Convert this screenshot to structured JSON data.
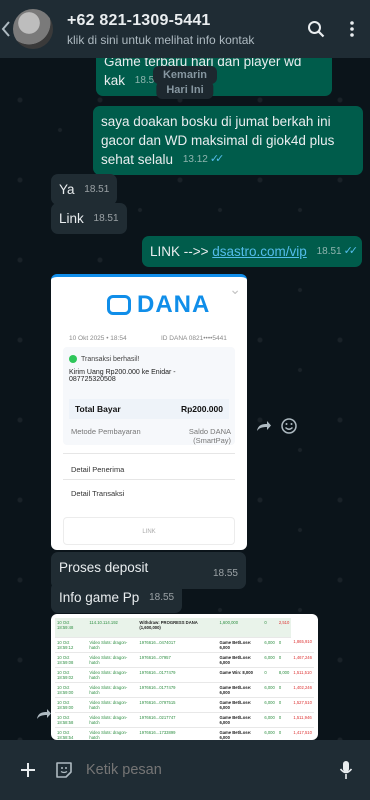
{
  "contact": {
    "name": "+62 821-1309-5441",
    "subtitle": "klik di sini untuk melihat info kontak"
  },
  "dates": {
    "yesterday": "Kemarin",
    "today": "Hari Ini"
  },
  "messages": {
    "cut_top": {
      "text": "Game terbaru hari dan player wd kak",
      "time": "18.58"
    },
    "prayer": {
      "text": "saya doakan bosku di jumat berkah ini gacor dan WD maksimal di giok4d plus sehat selalu",
      "time": "13.12"
    },
    "ya": {
      "text": "Ya",
      "time": "18.51"
    },
    "link_in": {
      "text": "Link",
      "time": "18.51"
    },
    "link_out": {
      "prefix": "LINK -->> ",
      "url": "dsastro.com/vip",
      "time": "18.51"
    },
    "deposit": {
      "text": "Proses deposit",
      "time": "18.55"
    },
    "info": {
      "text": "Info game Pp",
      "time": "18.55"
    }
  },
  "receipt": {
    "brand": "DANA",
    "date": "10 Okt 2025 • 18:54",
    "id": "ID DANA 0821••••5441",
    "status": "Transaksi berhasil!",
    "desc": "Kirim Uang Rp200.000 ke Enidar - 087725320508",
    "total_label": "Total Bayar",
    "total_value": "Rp200.000",
    "method_label": "Metode Pembayaran",
    "method_value": "Saldo DANA (SmartPay)",
    "receiver": "Detail Penerima",
    "transaction": "Detail Transaksi",
    "link_btn": "LINK"
  },
  "history": {
    "header": [
      "10 Oct 18:59:48",
      "114.10.114.192",
      "Withdraw: PROGRESS DANA (1,600,000)",
      "1,600,000",
      "0",
      "2,510"
    ],
    "rows": [
      [
        "10 Oct 18:59:12",
        "Video Slots: dragon-hatch",
        "1976616...0474017",
        "Game Bet/Lose: 6,000",
        "6,000",
        "0",
        "1,865,910"
      ],
      [
        "10 Oct 18:59:08",
        "Video Slots: dragon-hatch",
        "1976616...07957",
        "Game Bet/Lose: 6,000",
        "6,000",
        "0",
        "1,467,246"
      ],
      [
        "10 Oct 18:59:02",
        "Video Slots: dragon-hatch",
        "1976616...0177479",
        "Game Win: 8,000",
        "0",
        "8,000",
        "1,511,510"
      ],
      [
        "10 Oct 18:59:00",
        "Video Slots: dragon-hatch",
        "1976616...0177479",
        "Game Bet/Lose: 6,000",
        "6,000",
        "0",
        "1,402,246"
      ],
      [
        "10 Oct 18:59:00",
        "Video Slots: dragon-hatch",
        "1976616...0797515",
        "Game Bet/Lose: 6,000",
        "6,000",
        "0",
        "1,527,510"
      ],
      [
        "10 Oct 18:58:58",
        "Video Slots: dragon-hatch",
        "1976616...0217747",
        "Game Bet/Lose: 6,000",
        "6,000",
        "0",
        "1,511,946"
      ],
      [
        "10 Oct 18:58:54",
        "Video Slots: dragon-hatch",
        "1976616...1733899",
        "Game Bet/Lose: 6,000",
        "6,000",
        "0",
        "1,417,510"
      ]
    ]
  },
  "composer": {
    "placeholder": "Ketik pesan"
  },
  "colors": {
    "outgoing": "#005c4b",
    "incoming": "#202c33",
    "header": "#1f2c34",
    "check": "#53bdeb",
    "brand": "#108ee9"
  }
}
